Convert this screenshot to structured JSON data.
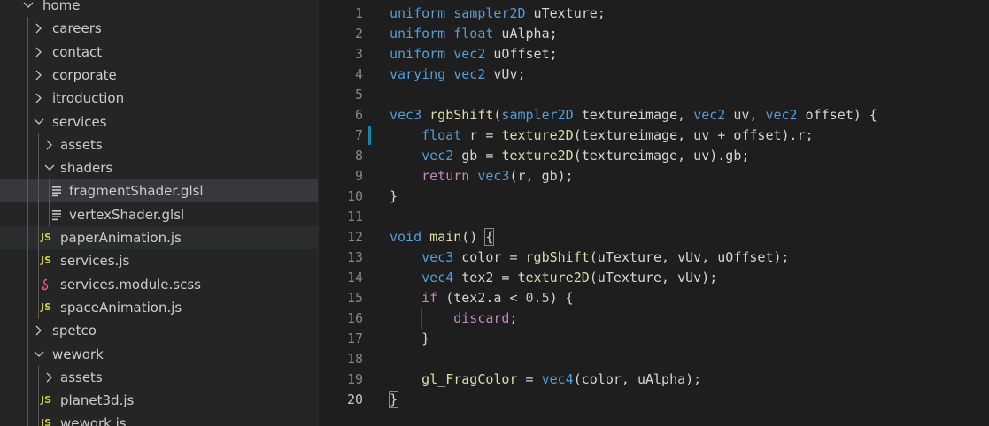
{
  "explorer": {
    "rows": [
      {
        "label": "home",
        "kind": "folder-open",
        "depth": 0
      },
      {
        "label": "careers",
        "kind": "folder",
        "depth": 1
      },
      {
        "label": "contact",
        "kind": "folder",
        "depth": 1
      },
      {
        "label": "corporate",
        "kind": "folder",
        "depth": 1
      },
      {
        "label": "itroduction",
        "kind": "folder",
        "depth": 1
      },
      {
        "label": "services",
        "kind": "folder-open",
        "depth": 1
      },
      {
        "label": "assets",
        "kind": "folder",
        "depth": 2
      },
      {
        "label": "shaders",
        "kind": "folder-open",
        "depth": 2
      },
      {
        "label": "fragmentShader.glsl",
        "kind": "glsl",
        "depth": 3,
        "selected": true
      },
      {
        "label": "vertexShader.glsl",
        "kind": "glsl",
        "depth": 3
      },
      {
        "label": "paperAnimation.js",
        "kind": "js",
        "depth": 2,
        "hover": true
      },
      {
        "label": "services.js",
        "kind": "js",
        "depth": 2
      },
      {
        "label": "services.module.scss",
        "kind": "scss",
        "depth": 2
      },
      {
        "label": "spaceAnimation.js",
        "kind": "js",
        "depth": 2
      },
      {
        "label": "spetco",
        "kind": "folder",
        "depth": 1
      },
      {
        "label": "wework",
        "kind": "folder-open",
        "depth": 1
      },
      {
        "label": "assets",
        "kind": "folder",
        "depth": 2
      },
      {
        "label": "planet3d.js",
        "kind": "js",
        "depth": 2
      },
      {
        "label": "wework.js",
        "kind": "js",
        "depth": 2
      }
    ],
    "js_badge": "JS"
  },
  "editor": {
    "active_line": 20,
    "modified_line": 7,
    "lines": [
      {
        "num": "1",
        "tokens": [
          [
            "k",
            "uniform"
          ],
          [
            "v",
            " "
          ],
          [
            "k",
            "sampler2D"
          ],
          [
            "v",
            " uTexture;"
          ]
        ]
      },
      {
        "num": "2",
        "tokens": [
          [
            "k",
            "uniform"
          ],
          [
            "v",
            " "
          ],
          [
            "k",
            "float"
          ],
          [
            "v",
            " uAlpha;"
          ]
        ]
      },
      {
        "num": "3",
        "tokens": [
          [
            "k",
            "uniform"
          ],
          [
            "v",
            " "
          ],
          [
            "k",
            "vec2"
          ],
          [
            "v",
            " uOffset;"
          ]
        ]
      },
      {
        "num": "4",
        "tokens": [
          [
            "k",
            "varying"
          ],
          [
            "v",
            " "
          ],
          [
            "k",
            "vec2"
          ],
          [
            "v",
            " vUv;"
          ]
        ]
      },
      {
        "num": "5",
        "tokens": []
      },
      {
        "num": "6",
        "tokens": [
          [
            "k",
            "vec3"
          ],
          [
            "v",
            " "
          ],
          [
            "f",
            "rgbShift"
          ],
          [
            "v",
            "("
          ],
          [
            "k",
            "sampler2D"
          ],
          [
            "v",
            " textureimage, "
          ],
          [
            "k",
            "vec2"
          ],
          [
            "v",
            " uv, "
          ],
          [
            "k",
            "vec2"
          ],
          [
            "v",
            " offset) {"
          ]
        ]
      },
      {
        "num": "7",
        "tokens": [
          [
            "v",
            "    "
          ],
          [
            "k",
            "float"
          ],
          [
            "v",
            " r = "
          ],
          [
            "f",
            "texture2D"
          ],
          [
            "v",
            "(textureimage, uv + offset).r;"
          ]
        ]
      },
      {
        "num": "8",
        "tokens": [
          [
            "v",
            "    "
          ],
          [
            "k",
            "vec2"
          ],
          [
            "v",
            " gb = "
          ],
          [
            "f",
            "texture2D"
          ],
          [
            "v",
            "(textureimage, uv).gb;"
          ]
        ]
      },
      {
        "num": "9",
        "tokens": [
          [
            "v",
            "    "
          ],
          [
            "c",
            "return"
          ],
          [
            "v",
            " "
          ],
          [
            "k",
            "vec3"
          ],
          [
            "v",
            "(r, gb);"
          ]
        ]
      },
      {
        "num": "10",
        "tokens": [
          [
            "v",
            "}"
          ]
        ]
      },
      {
        "num": "11",
        "tokens": []
      },
      {
        "num": "12",
        "tokens": [
          [
            "k",
            "void"
          ],
          [
            "v",
            " "
          ],
          [
            "f",
            "main"
          ],
          [
            "v",
            "() "
          ],
          [
            "b",
            "{"
          ]
        ]
      },
      {
        "num": "13",
        "tokens": [
          [
            "v",
            "    "
          ],
          [
            "k",
            "vec3"
          ],
          [
            "v",
            " color = "
          ],
          [
            "f",
            "rgbShift"
          ],
          [
            "v",
            "(uTexture, vUv, uOffset);"
          ]
        ]
      },
      {
        "num": "14",
        "tokens": [
          [
            "v",
            "    "
          ],
          [
            "k",
            "vec4"
          ],
          [
            "v",
            " tex2 = "
          ],
          [
            "f",
            "texture2D"
          ],
          [
            "v",
            "(uTexture, vUv);"
          ]
        ]
      },
      {
        "num": "15",
        "tokens": [
          [
            "v",
            "    "
          ],
          [
            "c",
            "if"
          ],
          [
            "v",
            " (tex2.a < "
          ],
          [
            "n",
            "0.5"
          ],
          [
            "v",
            ") {"
          ]
        ]
      },
      {
        "num": "16",
        "tokens": [
          [
            "v",
            "        "
          ],
          [
            "c",
            "discard"
          ],
          [
            "v",
            ";"
          ]
        ]
      },
      {
        "num": "17",
        "tokens": [
          [
            "v",
            "    }"
          ]
        ]
      },
      {
        "num": "18",
        "tokens": []
      },
      {
        "num": "19",
        "tokens": [
          [
            "v",
            "    "
          ],
          [
            "f",
            "gl_FragColor"
          ],
          [
            "v",
            " = "
          ],
          [
            "k",
            "vec4"
          ],
          [
            "v",
            "(color, uAlpha);"
          ]
        ]
      },
      {
        "num": "20",
        "tokens": [
          [
            "b",
            "}"
          ]
        ]
      }
    ]
  }
}
